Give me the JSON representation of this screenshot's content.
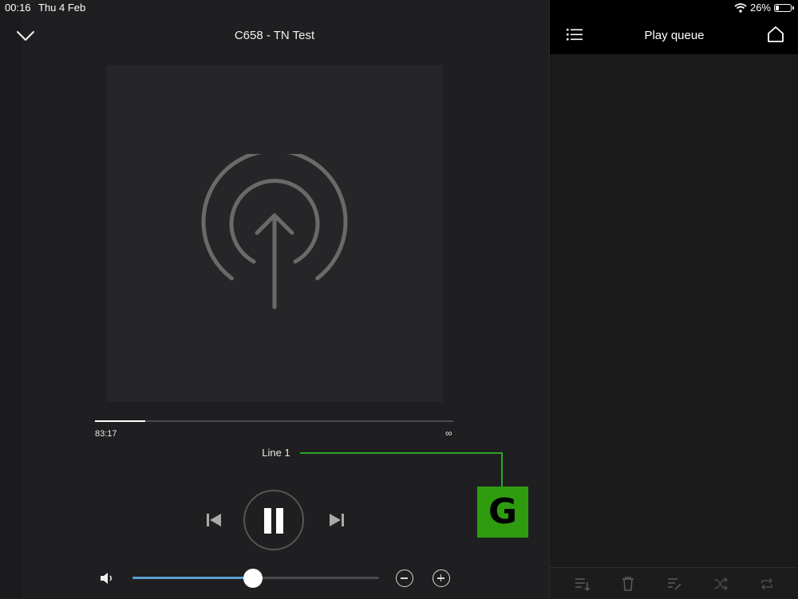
{
  "status": {
    "time": "00:16",
    "date": "Thu 4 Feb",
    "battery": "26%",
    "battery_level": 0.26
  },
  "player": {
    "title": "C658 - TN Test",
    "elapsed": "83:17",
    "duration": "∞",
    "progress": 0.14,
    "source_label": "Line 1",
    "volume": 0.49
  },
  "callout": {
    "letter": "G",
    "color": "#2f9c10"
  },
  "queue": {
    "title": "Play queue"
  },
  "icons": {
    "collapse": "chevron-down-icon",
    "artwork": "upload-broadcast-icon",
    "prev": "skip-previous-icon",
    "pause": "pause-icon",
    "next": "skip-next-icon",
    "speaker": "speaker-icon",
    "minus": "minus-circle-icon",
    "plus": "plus-circle-icon",
    "menu": "list-menu-icon",
    "home": "home-icon",
    "toolbar": [
      "sort-icon",
      "trash-icon",
      "edit-list-icon",
      "shuffle-icon",
      "repeat-icon"
    ]
  },
  "colors": {
    "accent": "#5aa0d0",
    "background": "#1f1f21",
    "callout_line": "#2aa52a"
  }
}
